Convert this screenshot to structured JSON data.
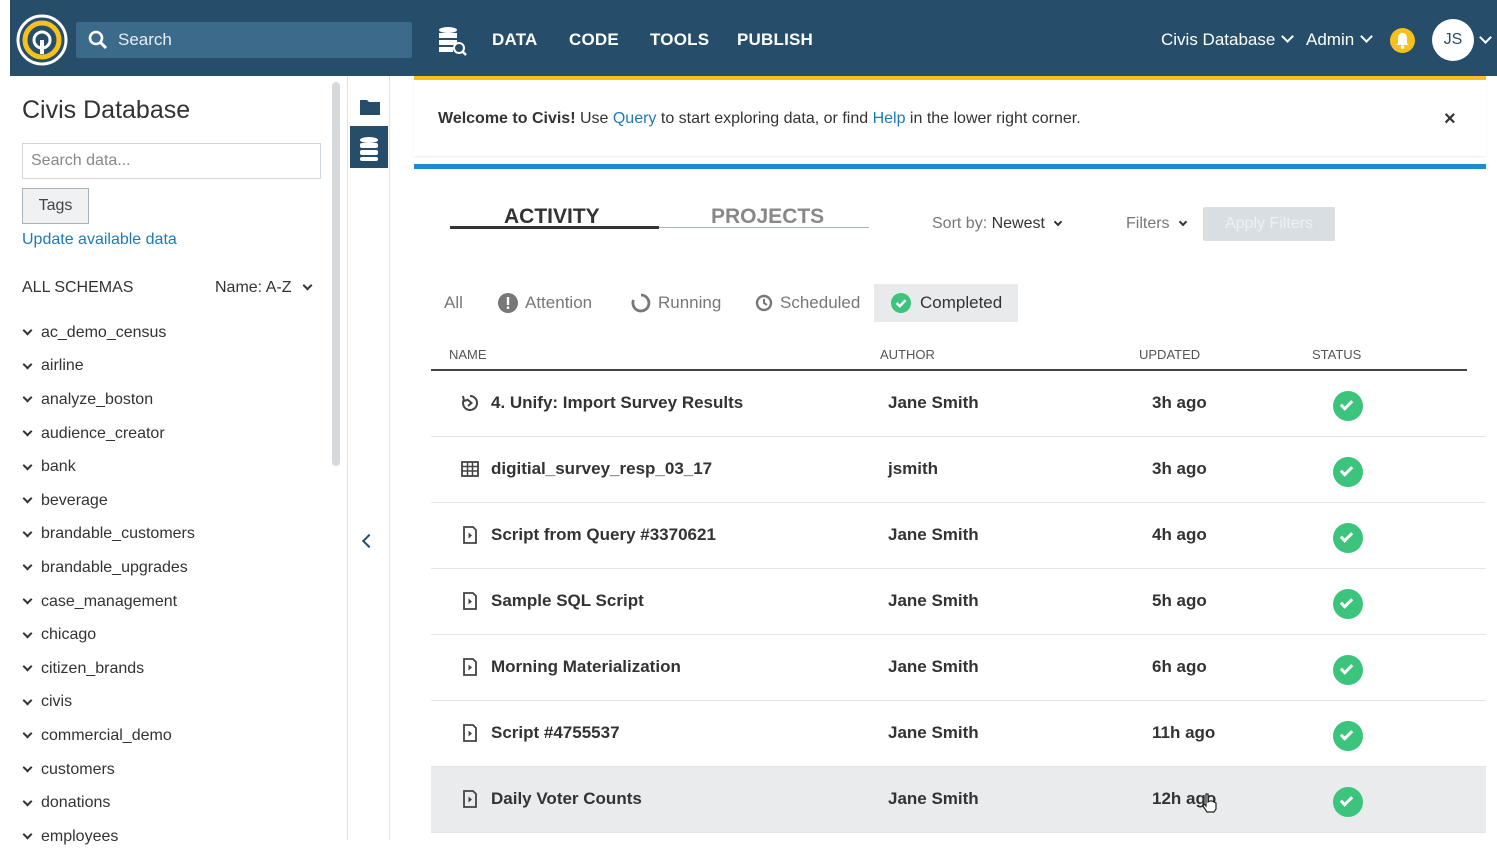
{
  "topnav": {
    "search_placeholder": "Search",
    "links": [
      "DATA",
      "CODE",
      "TOOLS",
      "PUBLISH"
    ],
    "database_selector": "Civis Database",
    "role_selector": "Admin",
    "avatar_initials": "JS",
    "accent": "#264E6B"
  },
  "sidebar": {
    "title": "Civis Database",
    "search_placeholder": "Search data...",
    "tags_button": "Tags",
    "update_link": "Update available data",
    "section_label": "ALL SCHEMAS",
    "sort_label": "Name: A-Z",
    "schemas": [
      "ac_demo_census",
      "airline",
      "analyze_boston",
      "audience_creator",
      "bank",
      "beverage",
      "brandable_customers",
      "brandable_upgrades",
      "case_management",
      "chicago",
      "citizen_brands",
      "civis",
      "commercial_demo",
      "customers",
      "donations",
      "employees"
    ]
  },
  "banner": {
    "welcome": "Welcome to Civis!",
    "text1": " Use ",
    "query_link": "Query",
    "text2": " to start exploring data, or find ",
    "help_link": "Help",
    "text3": " in the lower right corner.",
    "close": "×"
  },
  "main": {
    "tabs": [
      "ACTIVITY",
      "PROJECTS"
    ],
    "sort_prefix": "Sort by: ",
    "sort_value": "Newest",
    "filters_label": "Filters",
    "apply_button": "Apply Filters",
    "subtabs": [
      "All",
      "Attention",
      "Running",
      "Scheduled",
      "Completed"
    ],
    "columns": [
      "NAME",
      "AUTHOR",
      "UPDATED",
      "STATUS"
    ],
    "rows": [
      {
        "icon": "workflow-icon",
        "name": "4. Unify: Import Survey Results",
        "author": "Jane Smith",
        "updated": "3h ago"
      },
      {
        "icon": "table-icon",
        "name": "digitial_survey_resp_03_17",
        "author": "jsmith",
        "updated": "3h ago"
      },
      {
        "icon": "script-icon",
        "name": "Script from Query #3370621",
        "author": "Jane Smith",
        "updated": "4h ago"
      },
      {
        "icon": "script-icon",
        "name": "Sample SQL Script",
        "author": "Jane Smith",
        "updated": "5h ago"
      },
      {
        "icon": "script-icon",
        "name": "Morning Materialization",
        "author": "Jane Smith",
        "updated": "6h ago"
      },
      {
        "icon": "script-icon",
        "name": "Script #4755537",
        "author": "Jane Smith",
        "updated": "11h ago"
      },
      {
        "icon": "script-icon",
        "name": "Daily Voter Counts",
        "author": "Jane Smith",
        "updated": "12h ago"
      }
    ],
    "status_color": "#3CC47C"
  }
}
